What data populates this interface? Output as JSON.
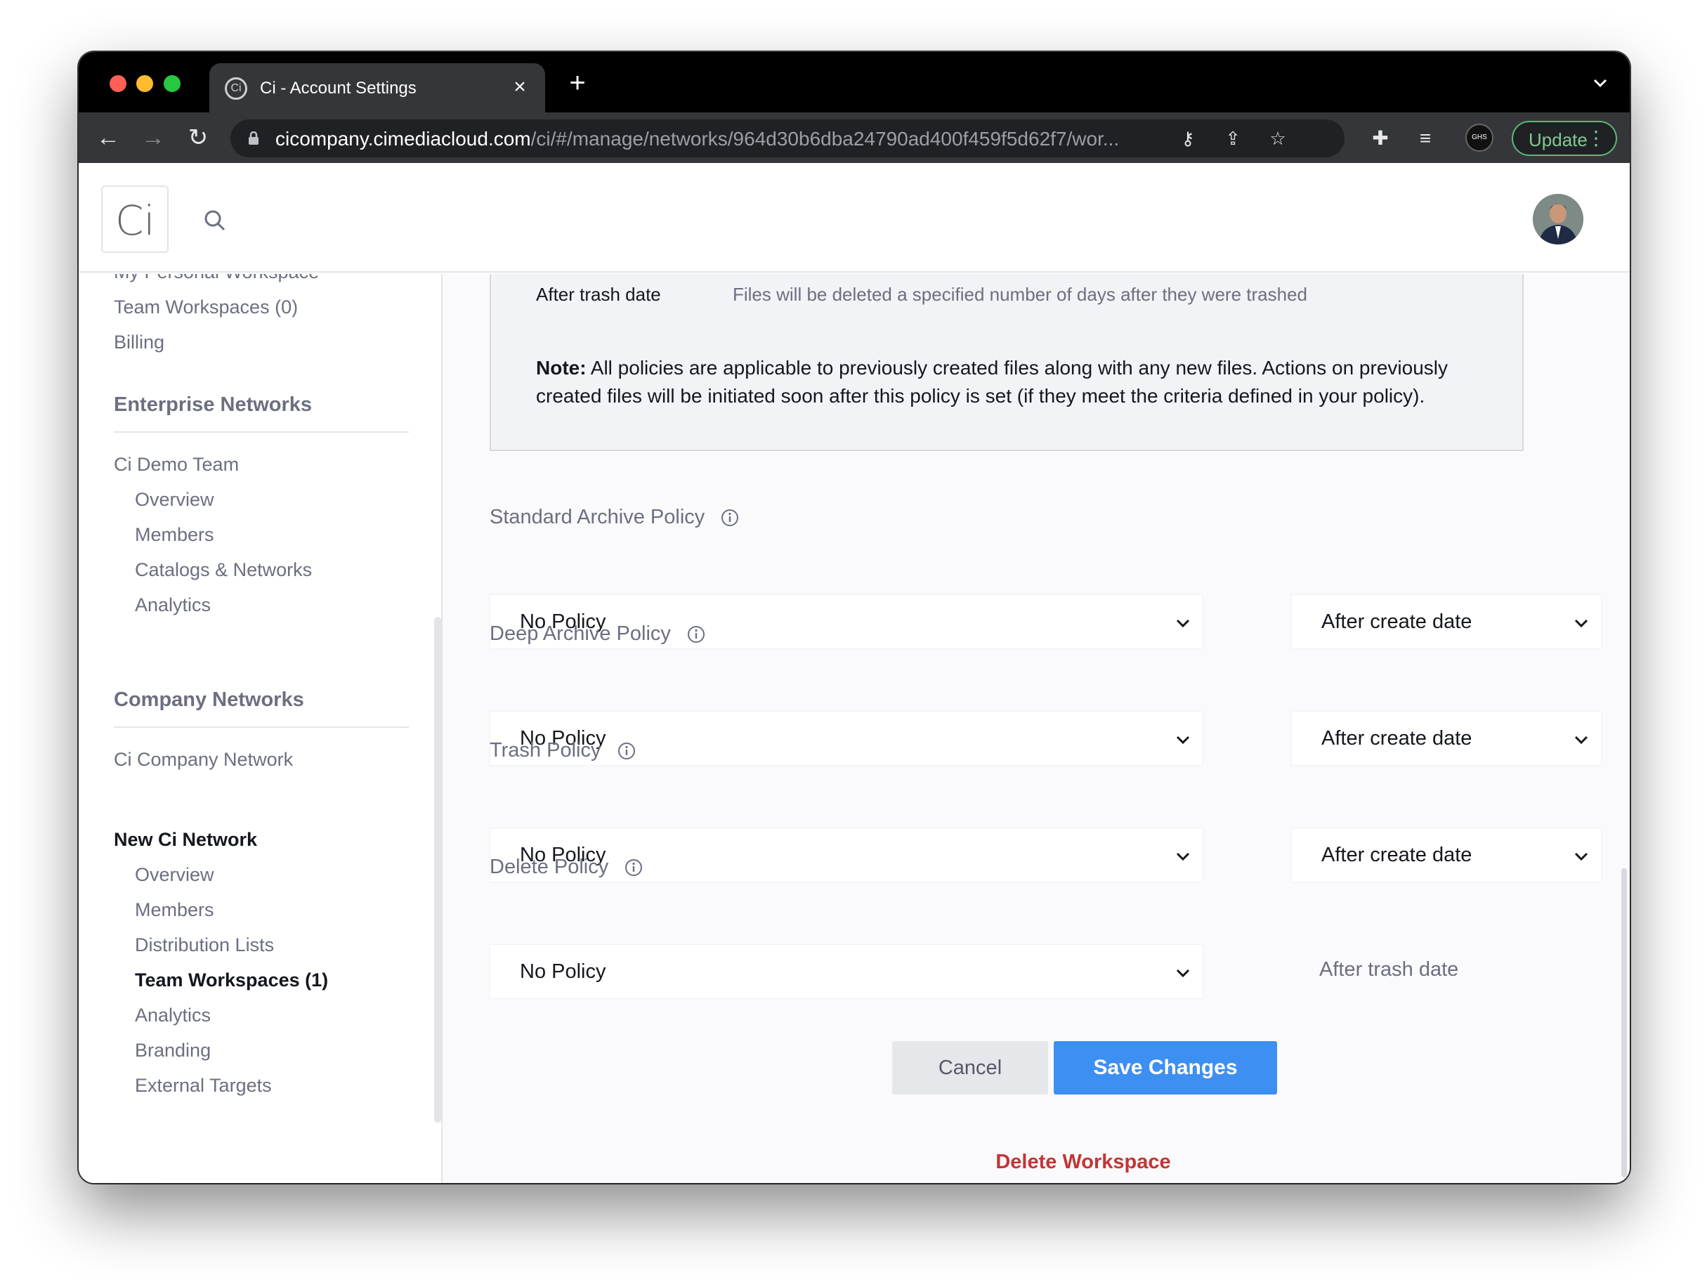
{
  "browser": {
    "tab_title": "Ci - Account Settings",
    "url_host": "cicompany.cimediacloud.com",
    "url_path": "/ci/#/manage/networks/964d30b6dba24790ad400f459f5d62f7/wor...",
    "update_label": "Update",
    "profile_badge": "GHS"
  },
  "app": {
    "logo_text": "Ci"
  },
  "sidebar": {
    "partial_item": "My Personal Workspace",
    "account_items": [
      "Team Workspaces (0)",
      "Billing"
    ],
    "enterprise_title": "Enterprise Networks",
    "enterprise_network": "Ci Demo Team",
    "enterprise_sub": [
      "Overview",
      "Members",
      "Catalogs & Networks",
      "Analytics"
    ],
    "company_title": "Company Networks",
    "company_network": "Ci Company Network",
    "new_network": "New Ci Network",
    "new_network_sub": [
      "Overview",
      "Members",
      "Distribution Lists",
      "Team Workspaces (1)",
      "Analytics",
      "Branding",
      "External Targets"
    ]
  },
  "info": {
    "term": "After trash date",
    "description": "Files will be deleted a specified number of days after they were trashed",
    "note_label": "Note:",
    "note_text": " All policies are applicable to previously created files along with any new files. Actions on previously created files will be initiated soon after this policy is set (if they meet the criteria defined in your policy)."
  },
  "policies": [
    {
      "label": "Standard Archive Policy",
      "value": "No Policy",
      "trigger": "After create date"
    },
    {
      "label": "Deep Archive Policy",
      "value": "No Policy",
      "trigger": "After create date"
    },
    {
      "label": "Trash Policy",
      "value": "No Policy",
      "trigger": "After create date"
    },
    {
      "label": "Delete Policy",
      "value": "No Policy",
      "trigger": "After trash date"
    }
  ],
  "actions": {
    "cancel": "Cancel",
    "save": "Save Changes",
    "delete": "Delete Workspace"
  },
  "colors": {
    "primary": "#3d8ff1",
    "danger": "#c53435",
    "update_green": "#81c995"
  }
}
